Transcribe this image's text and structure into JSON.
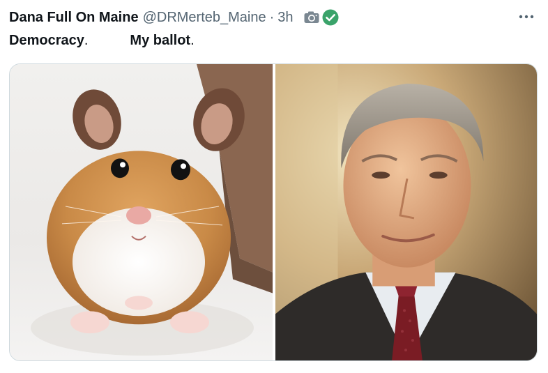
{
  "tweet": {
    "display_name": "Dana Full On Maine",
    "handle": "@DRMerteb_Maine",
    "separator": "·",
    "time": "3h",
    "icons": {
      "camera": "camera-icon",
      "verified": "verified-check-icon",
      "more": "more-options-icon"
    },
    "colors": {
      "verified": "#3aa36a",
      "camera": "#7a8791",
      "secondary_text": "#536471"
    },
    "caption": {
      "word1": "Democracy",
      "punct1": ".",
      "word2": "My ballot",
      "punct2": "."
    },
    "media": {
      "left_image": "hamster-photo",
      "right_image": "man-in-suit-photo"
    }
  }
}
